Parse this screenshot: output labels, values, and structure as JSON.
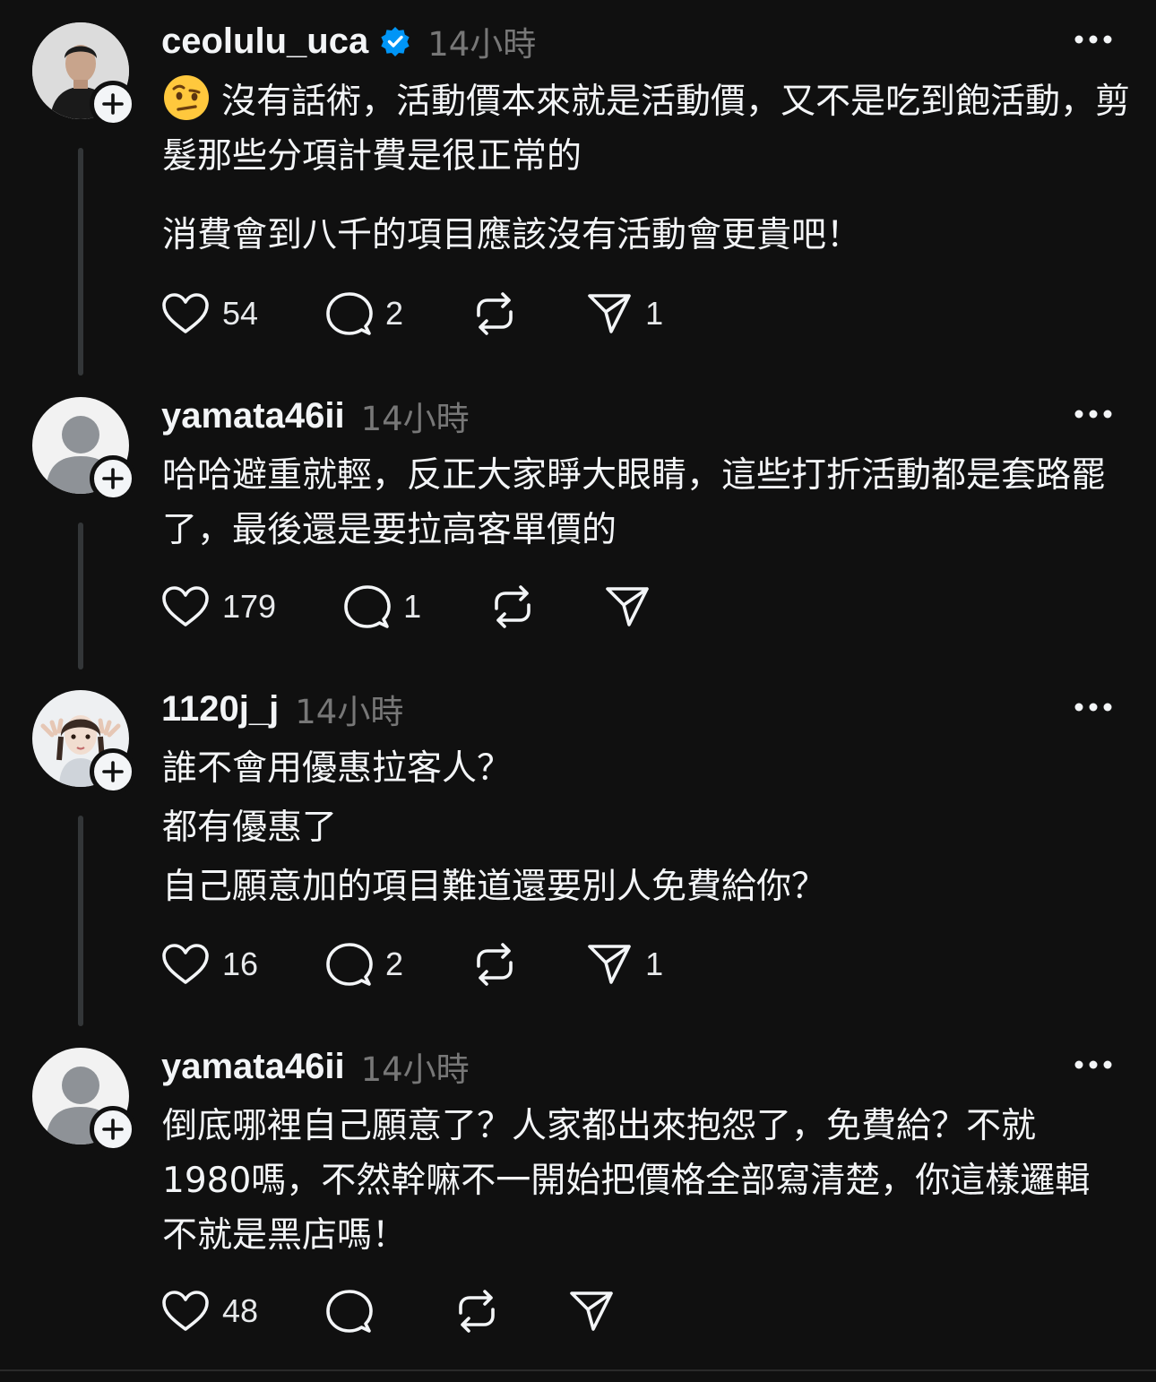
{
  "threads": [
    {
      "username": "ceolulu_uca",
      "verified": true,
      "time": "14小時",
      "paragraphs": [
        "沒有話術，活動價本來就是活動價，又不是吃到飽活動，剪髮那些分項計費是很正常的",
        "消費會到八千的項目應該沒有活動會更貴吧！"
      ],
      "likes": "54",
      "replies": "2",
      "reposts": "",
      "shares": "1"
    },
    {
      "username": "yamata46ii",
      "verified": false,
      "time": "14小時",
      "paragraphs": [
        "哈哈避重就輕，反正大家睜大眼睛，這些打折活動都是套路罷了，最後還是要拉高客單價的"
      ],
      "likes": "179",
      "replies": "1",
      "reposts": "",
      "shares": ""
    },
    {
      "username": "1120j_j",
      "verified": false,
      "time": "14小時",
      "paragraphs": [
        "誰不會用優惠拉客人？",
        "都有優惠了",
        "自己願意加的項目難道還要別人免費給你？"
      ],
      "likes": "16",
      "replies": "2",
      "reposts": "",
      "shares": "1"
    },
    {
      "username": "yamata46ii",
      "verified": false,
      "time": "14小時",
      "paragraphs": [
        "倒底哪裡自己願意了？人家都出來抱怨了，免費給？不就1980嗎，不然幹嘛不一開始把價格全部寫清楚，你這樣邏輯不就是黑店嗎！"
      ],
      "likes": "48",
      "replies": "",
      "reposts": "",
      "shares": ""
    }
  ],
  "colors": {
    "background": "#101010",
    "text": "#f3f5f7",
    "muted": "#777777",
    "verified": "#0095f6"
  }
}
